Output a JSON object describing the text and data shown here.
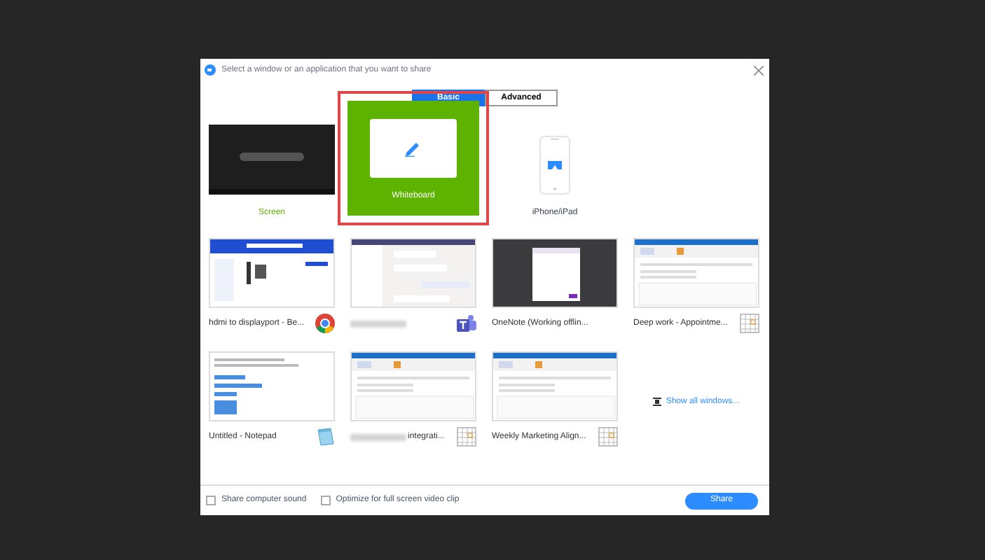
{
  "dialog": {
    "title": "Select a window or an application that you want to share"
  },
  "tabs": [
    {
      "label": "Basic",
      "selected": true
    },
    {
      "label": "Advanced",
      "selected": false
    }
  ],
  "sources": [
    {
      "kind": "screen",
      "label": "Screen",
      "selected": false
    },
    {
      "kind": "whiteboard",
      "label": "Whiteboard",
      "selected": true
    },
    {
      "kind": "device",
      "label": "iPhone/iPad",
      "selected": false
    }
  ],
  "windows": [
    {
      "kind": "browser",
      "icon": {
        "kind": "chrome"
      },
      "label": "hdmi to displayport - Be..."
    },
    {
      "kind": "chat",
      "icon": {
        "kind": "teams"
      },
      "redacted": true
    },
    {
      "kind": "dark",
      "label": "OneNote (Working offlin..."
    },
    {
      "kind": "outlook",
      "icon": {
        "kind": "calendar"
      },
      "label": "Deep work  - Appointme..."
    },
    {
      "kind": "notepad",
      "icon": {
        "kind": "notepad"
      },
      "label": "Untitled - Notepad"
    },
    {
      "kind": "outlook",
      "icon": {
        "kind": "calendar"
      },
      "redacted": true,
      "label": "integrati..."
    },
    {
      "kind": "outlook",
      "icon": {
        "kind": "calendar"
      },
      "label": "Weekly Marketing Align..."
    }
  ],
  "show_all": "Show all windows...",
  "options": [
    {
      "label": "Share computer sound",
      "checked": false
    },
    {
      "label": "Optimize for full screen video clip",
      "checked": false
    }
  ],
  "share_button": "Share"
}
